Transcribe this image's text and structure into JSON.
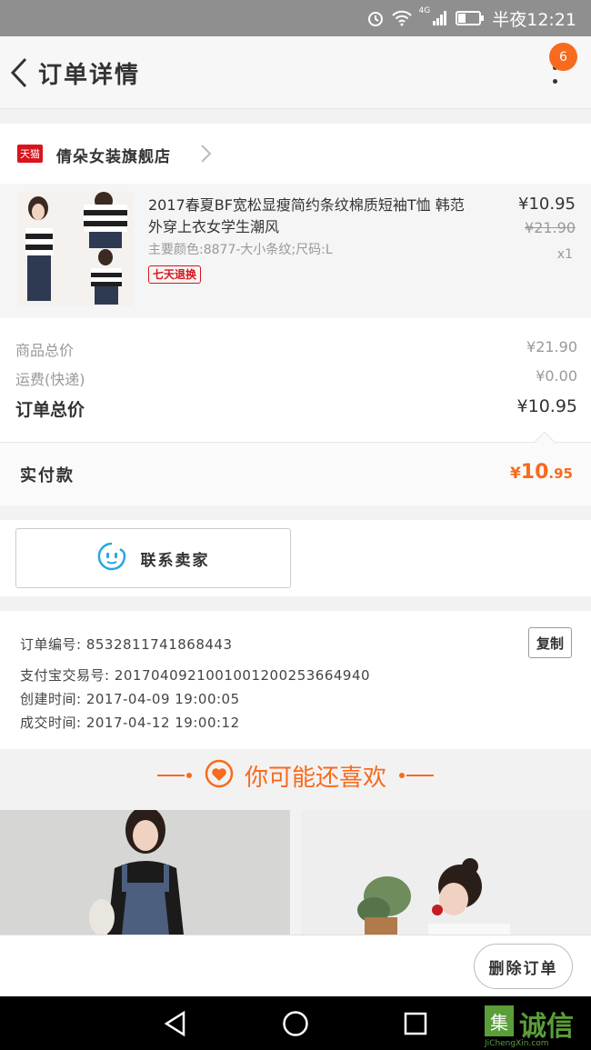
{
  "status_bar": {
    "network": "4G",
    "time": "半夜12:21"
  },
  "header": {
    "title": "订单详情",
    "badge_count": "6"
  },
  "shop": {
    "logo_text": "天猫",
    "name": "倩朵女装旗舰店"
  },
  "item": {
    "title": "2017春夏BF宽松显瘦简约条纹棉质短袖T恤 韩范外穿上衣女学生潮风",
    "sku": "主要颜色:8877-大小条纹;尺码:L",
    "tag": "七天退换",
    "price": "¥10.95",
    "original_price": "¥21.90",
    "quantity": "x1"
  },
  "totals": {
    "goods_label": "商品总价",
    "goods_value": "¥21.90",
    "shipping_label": "运费(快递)",
    "shipping_value": "¥0.00",
    "order_label": "订单总价",
    "order_value": "¥10.95"
  },
  "payment": {
    "label": "实付款",
    "yen": "¥",
    "integer": "10",
    "decimal": ".95"
  },
  "contact": {
    "label": "联系卖家"
  },
  "order_info": {
    "order_no": "订单编号: 8532811741868443",
    "alipay_no": "支付宝交易号: 2017040921001001200253664940",
    "created": "创建时间: 2017-04-09 19:00:05",
    "completed": "成交时间: 2017-04-12 19:00:12",
    "copy_label": "复制"
  },
  "recommend": {
    "title": "你可能还喜欢"
  },
  "bottom": {
    "delete_label": "删除订单"
  },
  "watermark": {
    "icon_text": "集",
    "text": "诚信",
    "sub": "JiChengXin.com"
  },
  "colors": {
    "accent": "#f86a1d",
    "tmall_red": "#d8141c",
    "contact_blue": "#2aa6e0"
  }
}
